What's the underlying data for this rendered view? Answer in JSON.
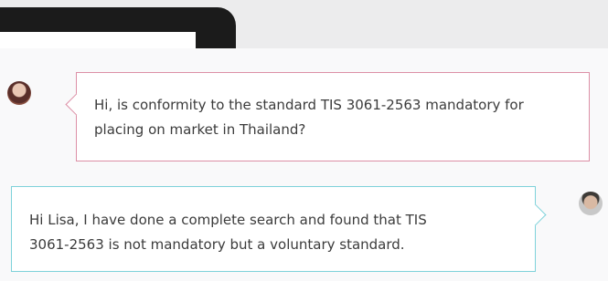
{
  "conversation": {
    "messages": [
      {
        "sender": "user",
        "text": "Hi, is conformity to the standard TIS 3061-2563 mandatory for\nplacing on market in Thailand?"
      },
      {
        "sender": "agent",
        "text": "Hi Lisa, I have done a complete search and found that TIS\n3061-2563 is not mandatory but a voluntary standard."
      }
    ]
  },
  "colors": {
    "user_bubble_border": "#dc8fa6",
    "agent_bubble_border": "#7ed2da",
    "text": "#3b3b3b"
  }
}
